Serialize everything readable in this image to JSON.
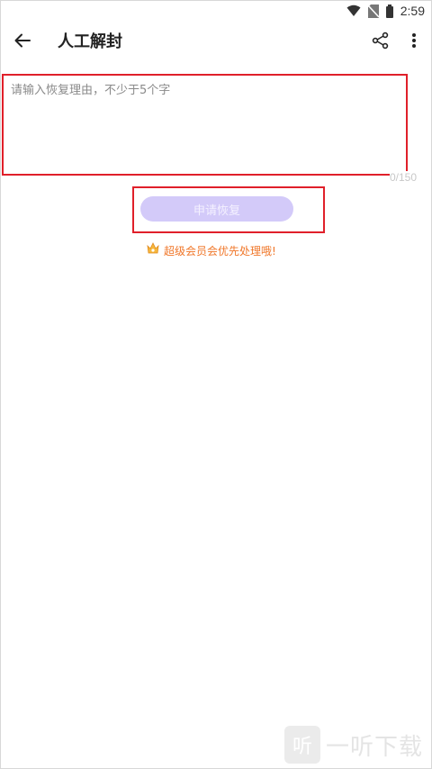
{
  "status_bar": {
    "time": "2:59",
    "icons": [
      "wifi-icon",
      "no-sim-icon",
      "battery-icon"
    ]
  },
  "app_bar": {
    "title": "人工解封",
    "back_icon": "arrow-left-icon",
    "share_icon": "share-icon",
    "more_icon": "more-vertical-icon"
  },
  "form": {
    "reason_value": "",
    "reason_placeholder": "请输入恢复理由，不少于5个字",
    "counter": "0/150",
    "submit_label": "申请恢复"
  },
  "vip_tip": {
    "icon": "vip-crown-icon",
    "text": "超级会员会优先处理哦!"
  },
  "watermark": {
    "logo_char": "听",
    "text": "一听下载"
  },
  "colors": {
    "submit_bg": "#d3caf9",
    "tip_text": "#f0772a",
    "highlight_border": "#e0202a"
  }
}
